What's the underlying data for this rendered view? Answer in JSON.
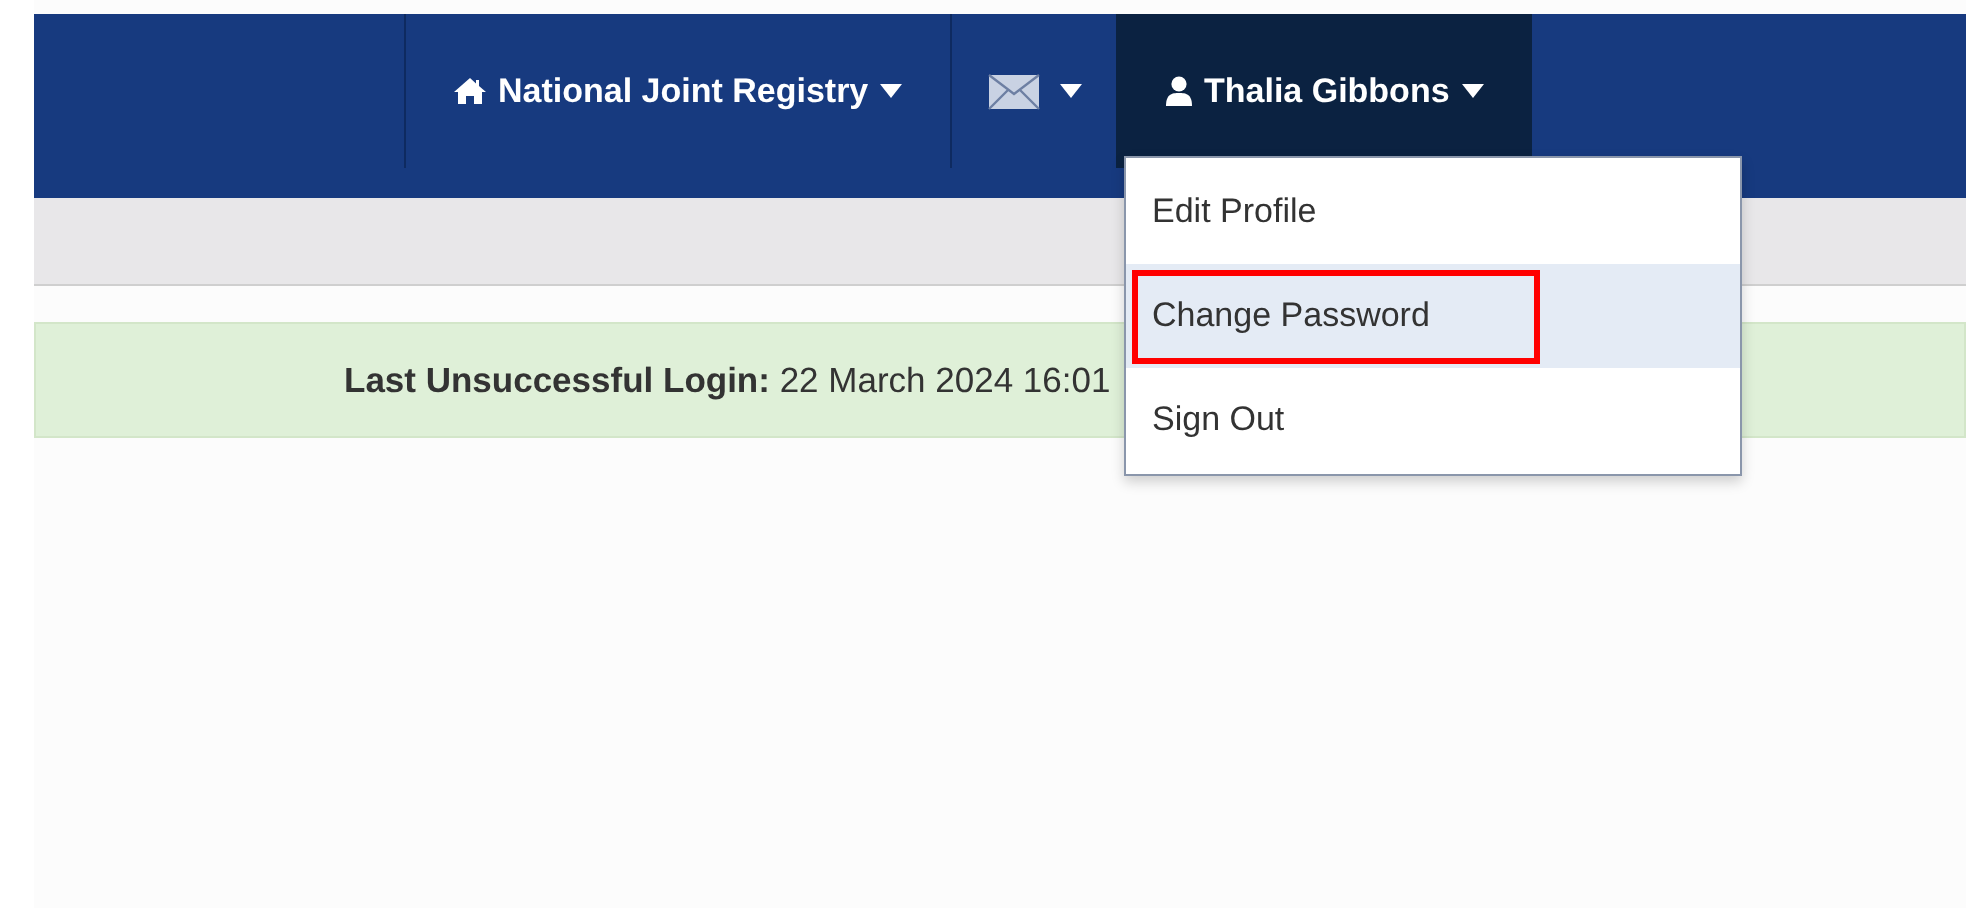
{
  "navbar": {
    "items": [
      {
        "kind": "home",
        "label": "National Joint Registry",
        "expanded": false
      },
      {
        "kind": "mail",
        "expanded": false
      },
      {
        "kind": "user",
        "label": "Thalia Gibbons",
        "expanded": true
      }
    ]
  },
  "user_menu": {
    "items": [
      {
        "label": "Edit Profile",
        "selected": false,
        "highlighted": false
      },
      {
        "label": "Change Password",
        "selected": true,
        "highlighted": true
      },
      {
        "label": "Sign Out",
        "selected": false,
        "highlighted": false
      }
    ]
  },
  "alert": {
    "text": "**Last Unsuccessful Login:** 22 March 2024 16:01"
  }
}
